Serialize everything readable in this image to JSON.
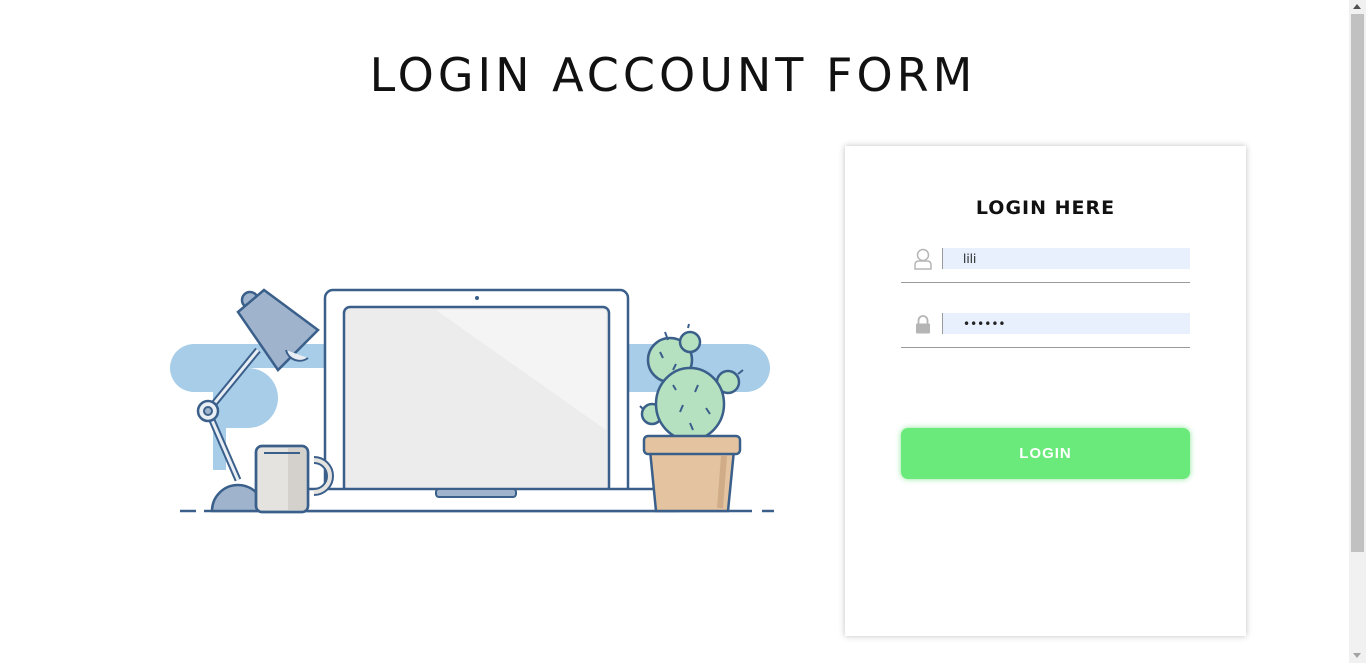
{
  "page": {
    "title": "LOGIN ACCOUNT FORM"
  },
  "illustration": {
    "name": "desk-workspace-illustration"
  },
  "login_card": {
    "heading": "LOGIN HERE",
    "username": {
      "icon": "user-icon",
      "value": "lili"
    },
    "password": {
      "icon": "lock-icon",
      "value": "••••••"
    },
    "submit_label": "LOGIN"
  },
  "colors": {
    "accent": "#6aea7a",
    "input_background": "#e8f0fe",
    "illustration_blue": "#a8cde8",
    "illustration_outline": "#3a5f8a"
  }
}
